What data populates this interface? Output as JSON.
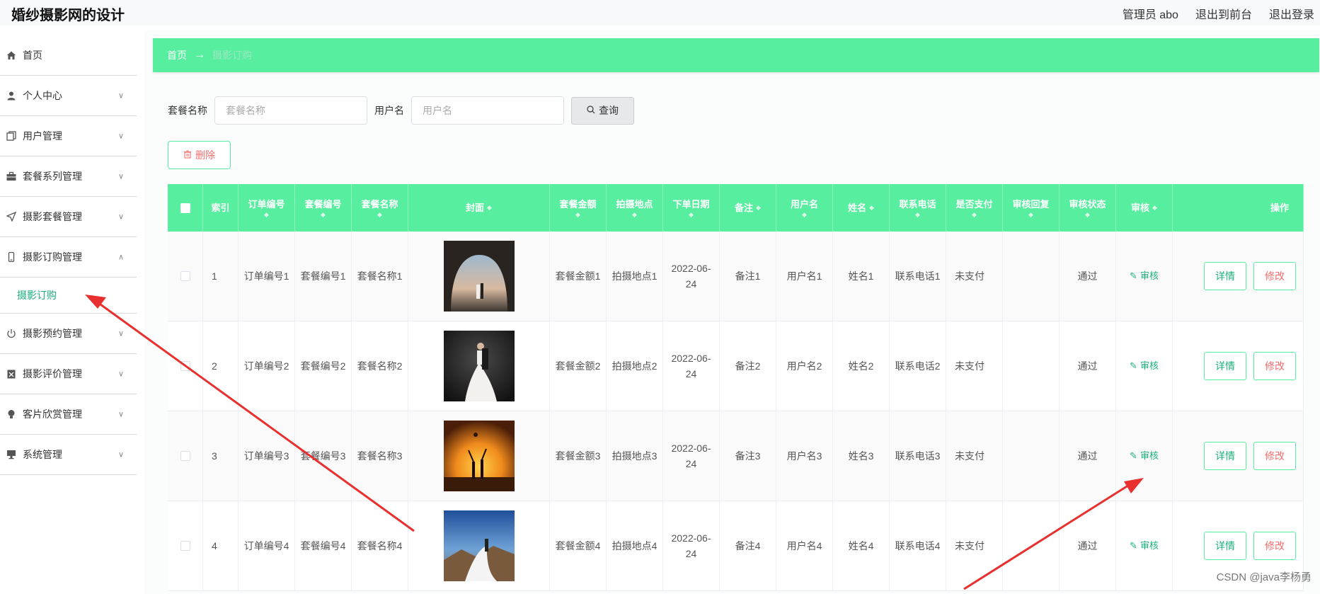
{
  "app": {
    "title": "婚纱摄影网的设计",
    "admin_label": "管理员 abo",
    "to_front": "退出到前台",
    "logout": "退出登录"
  },
  "sidebar": {
    "items": [
      {
        "label": "首页",
        "icon": "home-icon"
      },
      {
        "label": "个人中心",
        "icon": "user-icon"
      },
      {
        "label": "用户管理",
        "icon": "copy-icon"
      },
      {
        "label": "套餐系列管理",
        "icon": "briefcase-icon"
      },
      {
        "label": "摄影套餐管理",
        "icon": "send-icon"
      },
      {
        "label": "摄影订购管理",
        "icon": "phone-icon"
      },
      {
        "label": "摄影预约管理",
        "icon": "power-icon"
      },
      {
        "label": "摄影评价管理",
        "icon": "clipboard-icon"
      },
      {
        "label": "客片欣赏管理",
        "icon": "bulb-icon"
      },
      {
        "label": "系统管理",
        "icon": "monitor-icon"
      }
    ],
    "subitem": "摄影订购"
  },
  "breadcrumb": {
    "home": "首页",
    "arrow": "→",
    "current": "摄影订购"
  },
  "search": {
    "label1": "套餐名称",
    "placeholder1": "套餐名称",
    "label2": "用户名",
    "placeholder2": "用户名",
    "button": "查询"
  },
  "delete_button": "删除",
  "table": {
    "headers": [
      "索引",
      "订单编号",
      "套餐编号",
      "套餐名称",
      "封面",
      "套餐金额",
      "拍摄地点",
      "下单日期",
      "备注",
      "用户名",
      "姓名",
      "联系电话",
      "是否支付",
      "审核回复",
      "审核状态",
      "审核",
      "操作"
    ],
    "rows": [
      {
        "idx": "1",
        "order": "订单编号1",
        "pkg_no": "套餐编号1",
        "pkg_name": "套餐名称1",
        "amount": "套餐金额1",
        "place": "拍摄地点1",
        "date": "2022-06-24",
        "note": "备注1",
        "user": "用户名1",
        "name": "姓名1",
        "phone": "联系电话1",
        "paid": "未支付",
        "reply": "",
        "status": "通过",
        "audit": "审核",
        "detail": "详情",
        "edit": "修改"
      },
      {
        "idx": "2",
        "order": "订单编号2",
        "pkg_no": "套餐编号2",
        "pkg_name": "套餐名称2",
        "amount": "套餐金额2",
        "place": "拍摄地点2",
        "date": "2022-06-24",
        "note": "备注2",
        "user": "用户名2",
        "name": "姓名2",
        "phone": "联系电话2",
        "paid": "未支付",
        "reply": "",
        "status": "通过",
        "audit": "审核",
        "detail": "详情",
        "edit": "修改"
      },
      {
        "idx": "3",
        "order": "订单编号3",
        "pkg_no": "套餐编号3",
        "pkg_name": "套餐名称3",
        "amount": "套餐金额3",
        "place": "拍摄地点3",
        "date": "2022-06-24",
        "note": "备注3",
        "user": "用户名3",
        "name": "姓名3",
        "phone": "联系电话3",
        "paid": "未支付",
        "reply": "",
        "status": "通过",
        "audit": "审核",
        "detail": "详情",
        "edit": "修改"
      },
      {
        "idx": "4",
        "order": "订单编号4",
        "pkg_no": "套餐编号4",
        "pkg_name": "套餐名称4",
        "amount": "套餐金额4",
        "place": "拍摄地点4",
        "date": "2022-06-24",
        "note": "备注4",
        "user": "用户名4",
        "name": "姓名4",
        "phone": "联系电话4",
        "paid": "未支付",
        "reply": "",
        "status": "通过",
        "audit": "审核",
        "detail": "详情",
        "edit": "修改"
      }
    ]
  },
  "watermark": "CSDN @java李杨勇",
  "colors": {
    "accent": "#58ee9f",
    "danger": "#f56c6c",
    "annotation": "#e8312f"
  }
}
